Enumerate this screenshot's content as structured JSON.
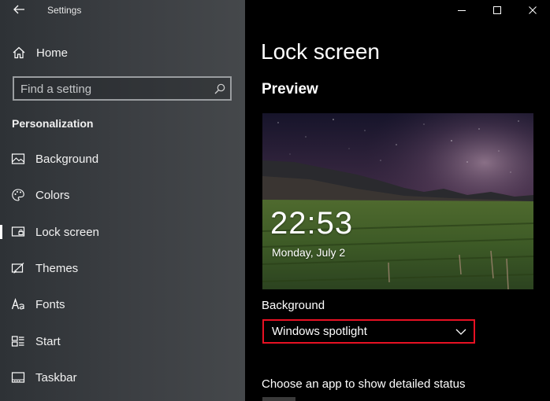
{
  "window": {
    "title": "Settings"
  },
  "sidebar": {
    "home_label": "Home",
    "search_placeholder": "Find a setting",
    "section_title": "Personalization",
    "items": [
      {
        "label": "Background",
        "icon": "picture-icon"
      },
      {
        "label": "Colors",
        "icon": "palette-icon"
      },
      {
        "label": "Lock screen",
        "icon": "lock-screen-icon",
        "selected": true
      },
      {
        "label": "Themes",
        "icon": "themes-icon"
      },
      {
        "label": "Fonts",
        "icon": "fonts-icon"
      },
      {
        "label": "Start",
        "icon": "start-icon"
      },
      {
        "label": "Taskbar",
        "icon": "taskbar-icon"
      }
    ]
  },
  "main": {
    "page_title": "Lock screen",
    "preview_heading": "Preview",
    "preview": {
      "time": "22:53",
      "date": "Monday, July 2"
    },
    "background_label": "Background",
    "background_value": "Windows spotlight",
    "status_label": "Choose an app to show detailed status"
  },
  "colors": {
    "accent_border": "#e81123",
    "sidebar_bg": "#3c3f43",
    "main_bg": "#000000"
  }
}
